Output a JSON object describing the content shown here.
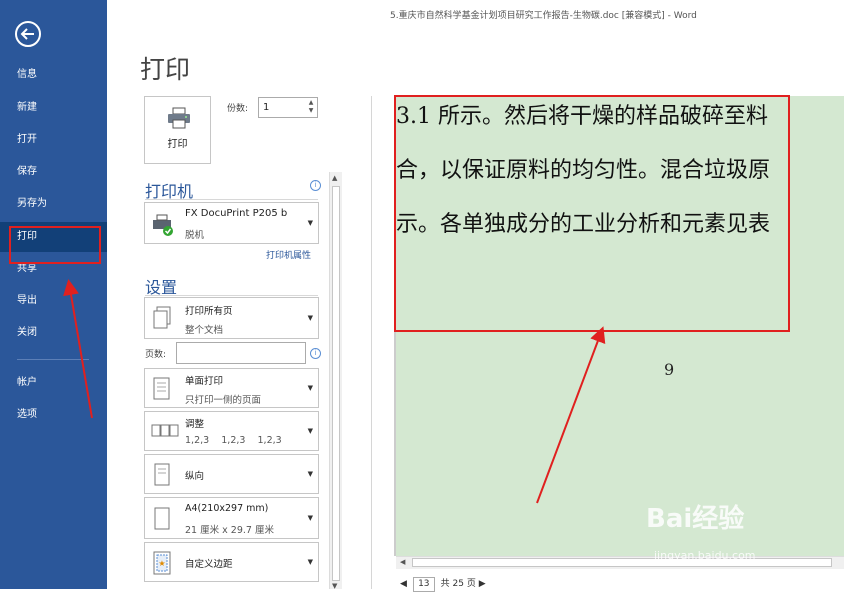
{
  "window": {
    "title": "5.重庆市自然科学基金计划项目研究工作报告-生物碳.doc [兼容模式] - Word"
  },
  "nav": {
    "items": [
      {
        "label": "信息"
      },
      {
        "label": "新建"
      },
      {
        "label": "打开"
      },
      {
        "label": "保存"
      },
      {
        "label": "另存为"
      },
      {
        "label": "打印"
      },
      {
        "label": "共享"
      },
      {
        "label": "导出"
      },
      {
        "label": "关闭"
      },
      {
        "label": "帐户"
      },
      {
        "label": "选项"
      }
    ],
    "active": "打印",
    "colors": {
      "background": "#2b579a",
      "active": "#124078"
    }
  },
  "page": {
    "title": "打印"
  },
  "print": {
    "button_label": "打印",
    "copies_label": "份数:",
    "copies_value": "1"
  },
  "printer": {
    "heading": "打印机",
    "name": "FX DocuPrint P205 b",
    "status": "脱机",
    "properties_link": "打印机属性"
  },
  "settings": {
    "heading": "设置",
    "pages_label": "页数:",
    "pages_value": "",
    "options": [
      {
        "line1": "打印所有页",
        "line2": "整个文档",
        "icon": "pages-icon"
      },
      {
        "line1": "单面打印",
        "line2": "只打印一侧的页面",
        "icon": "one-sided-icon"
      },
      {
        "line1": "调整",
        "line2": "1,2,3    1,2,3    1,2,3",
        "icon": "collate-icon"
      },
      {
        "line1": "纵向",
        "line2": "",
        "icon": "portrait-icon"
      },
      {
        "line1": "A4(210x297 mm)",
        "line2": "21 厘米 x 29.7 厘米",
        "icon": "paper-size-icon"
      },
      {
        "line1": "自定义边距",
        "line2": "",
        "icon": "margins-icon"
      }
    ]
  },
  "preview": {
    "lines": [
      "3.1 所示。然后将干燥的样品破碎至料",
      "合，以保证原料的均匀性。混合垃圾原",
      "示。各单独成分的工业分析和元素见表"
    ],
    "page_number": "9",
    "background": "#d4e8d1"
  },
  "page_nav": {
    "current": "13",
    "total": "共 25 页"
  },
  "annotations": {
    "color": "#e0201f"
  },
  "watermark": {
    "brand": "Bai经验",
    "url": "jingyan.baidu.com"
  }
}
